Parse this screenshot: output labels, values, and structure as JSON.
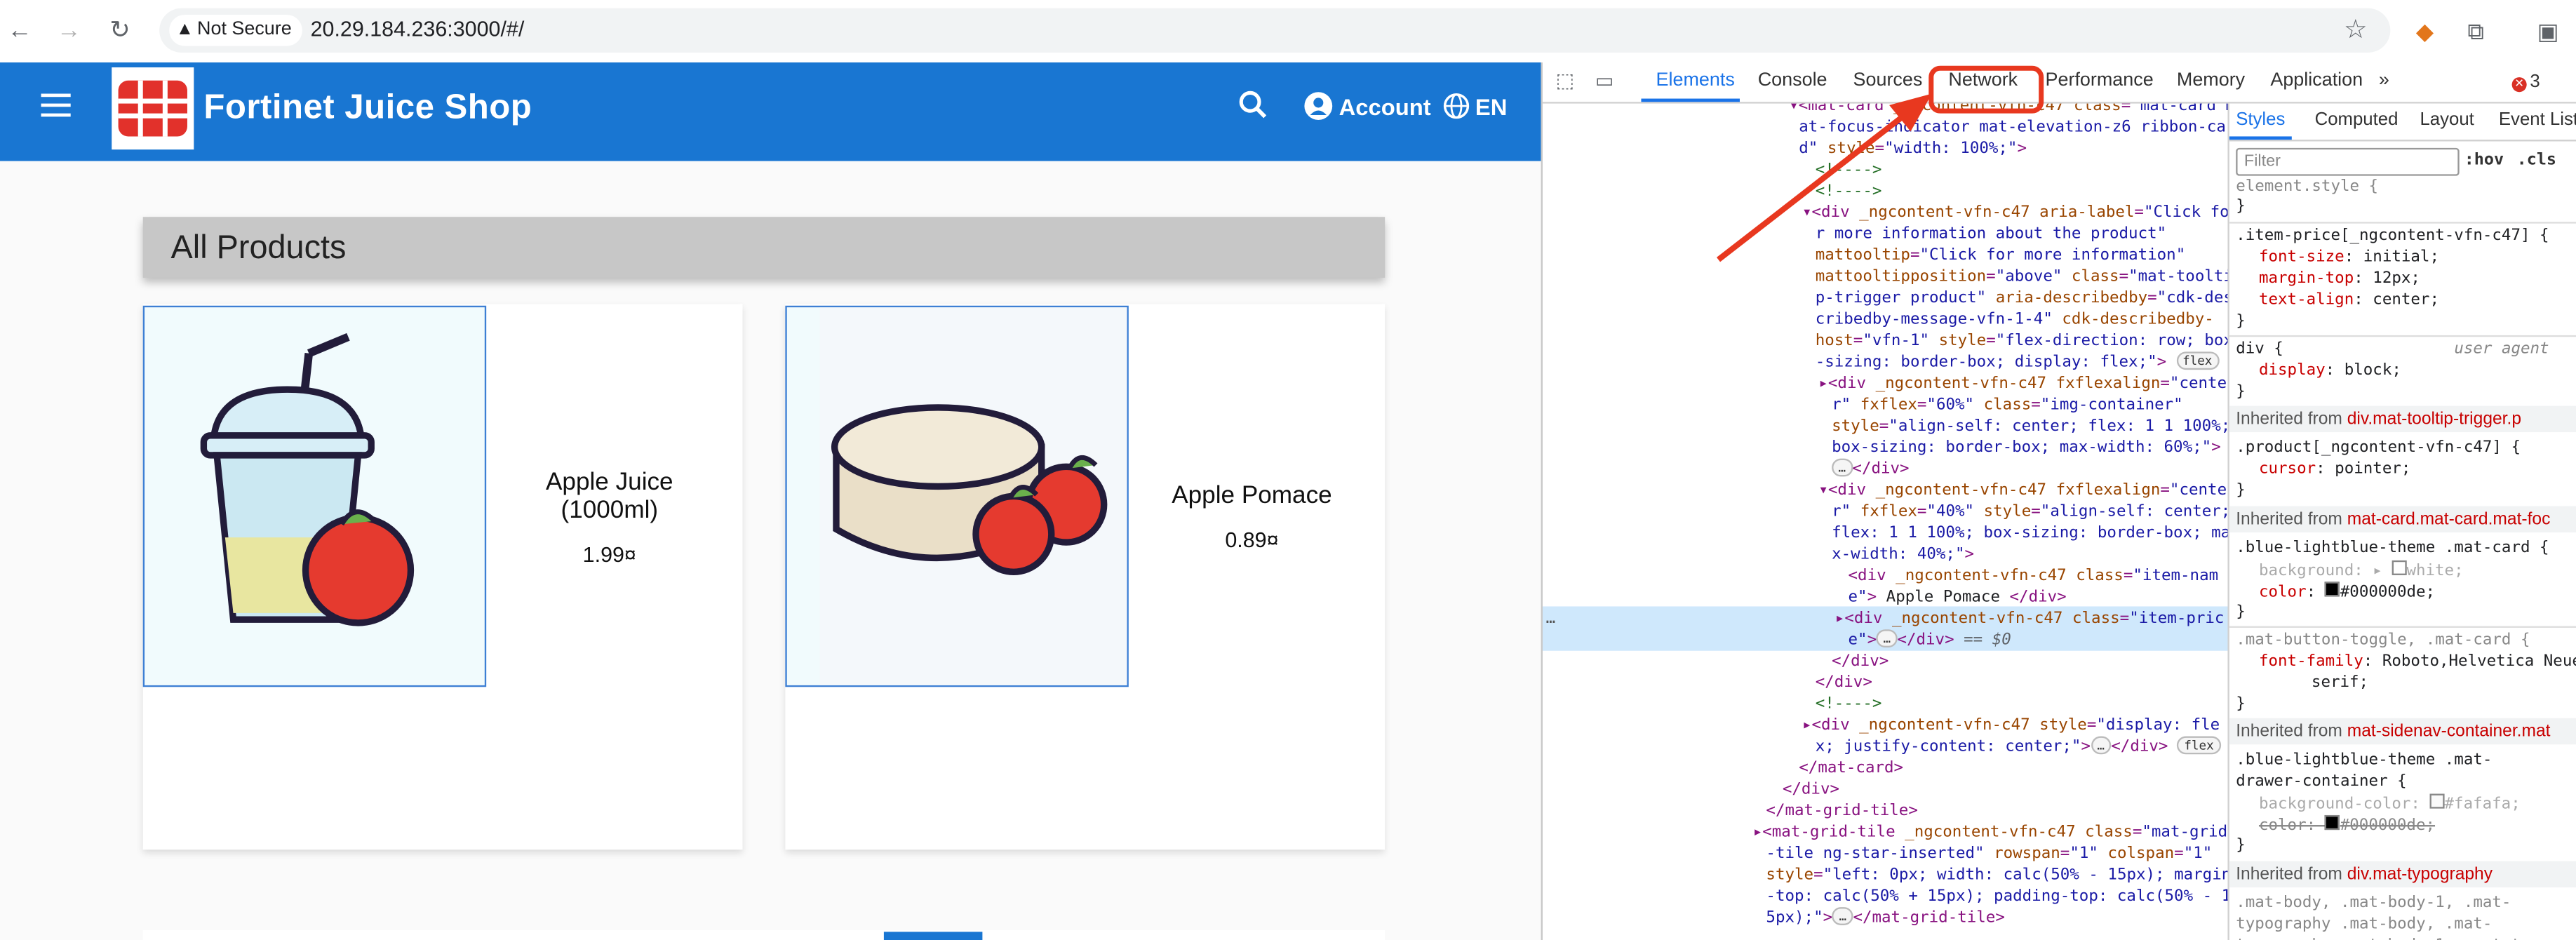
{
  "browser": {
    "security_label": "Not Secure",
    "url": "20.29.184.236:3000/#/"
  },
  "app": {
    "title": "Fortinet Juice Shop",
    "account_label": "Account",
    "language_label": "EN",
    "section_heading": "All Products",
    "products": [
      {
        "name": "Apple Juice (1000ml)",
        "price": "1.99¤"
      },
      {
        "name": "Apple Pomace",
        "price": "0.89¤"
      }
    ]
  },
  "devtools": {
    "tabs": [
      "Elements",
      "Console",
      "Sources",
      "Network",
      "Performance",
      "Memory",
      "Application"
    ],
    "more_tabs": "»",
    "error_count": "3",
    "active_tab": "Elements",
    "highlighted_tab": "Network",
    "styles_tabs": [
      "Styles",
      "Computed",
      "Layout",
      "Event Listeners"
    ],
    "filter_placeholder": "Filter",
    "hov_label": ":hov",
    "cls_label": ".cls",
    "selected_node_marker": "== $0",
    "ellipsis": "…"
  },
  "colors": {
    "toolbar": "#1976d2",
    "annotation": "#e8381f",
    "devtools_active": "#1a73e8"
  },
  "icons": [
    "back-icon",
    "forward-icon",
    "reload-icon",
    "warning-icon",
    "star-icon",
    "fox-extension-icon",
    "puzzle-icon",
    "sidebar-icon",
    "menu-icon",
    "search-icon",
    "account-icon",
    "globe-icon",
    "inspect-icon",
    "device-icon",
    "error-icon",
    "arrow-icon"
  ]
}
